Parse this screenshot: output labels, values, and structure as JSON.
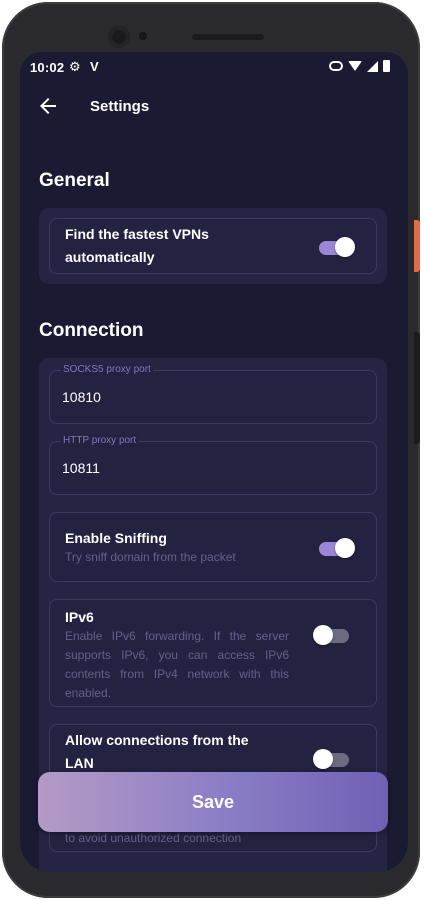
{
  "status_bar": {
    "time": "10:02",
    "settings_icon": "gear-icon",
    "app_icon": "v-logo-icon",
    "right_icons": [
      "key-icon",
      "wifi-icon",
      "signal-icon",
      "battery-icon"
    ]
  },
  "app_bar": {
    "back_icon": "arrow-left-icon",
    "title": "Settings"
  },
  "sections": {
    "general": {
      "title": "General",
      "fastest_vpn": {
        "label": "Find the fastest VPNs automatically",
        "enabled": true
      }
    },
    "connection": {
      "title": "Connection",
      "socks5": {
        "label": "SOCKS5 proxy port",
        "value": "10810"
      },
      "http": {
        "label": "HTTP proxy port",
        "value": "10811"
      },
      "sniffing": {
        "label": "Enable Sniffing",
        "description": "Try sniff domain from the packet",
        "enabled": true
      },
      "ipv6": {
        "label": "IPv6",
        "description": "Enable IPv6 forwarding. If the server supports IPv6, you can access IPv6 contents from IPv4 network with this enabled.",
        "enabled": false
      },
      "lan": {
        "label": "Allow connections from the LAN",
        "description_visible": "to avoid unauthorized connection",
        "enabled": false
      }
    }
  },
  "save_button": {
    "label": "Save"
  },
  "colors": {
    "background": "#1b1a33",
    "card": "#232240",
    "accent": "#9b86d6",
    "save_gradient_start": "#b49ac6",
    "save_gradient_end": "#7060b4",
    "side_button": "#e06c4c"
  }
}
